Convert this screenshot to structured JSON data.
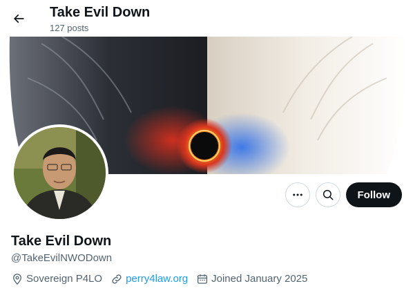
{
  "header": {
    "title": "Take Evil Down",
    "posts_count": "127 posts",
    "back_icon": "arrow-left-icon"
  },
  "banner": {
    "description_icon": "banner-image",
    "colors": {
      "left_lion": "#3a3f4a",
      "right_lion": "#efe9df",
      "orb": "#f7a21b"
    }
  },
  "avatar": {
    "icon": "profile-photo"
  },
  "actions": {
    "more_icon": "more-icon",
    "search_icon": "search-icon",
    "follow_label": "Follow"
  },
  "profile": {
    "name": "Take Evil Down",
    "handle": "@TakeEvilNWODown",
    "location": "Sovereign P4LO",
    "website": "perry4law.org",
    "joined": "Joined January 2025"
  },
  "colors": {
    "accent": "#1d9bf0",
    "text": "#0f1419",
    "muted": "#536471",
    "button": "#0f1419"
  }
}
